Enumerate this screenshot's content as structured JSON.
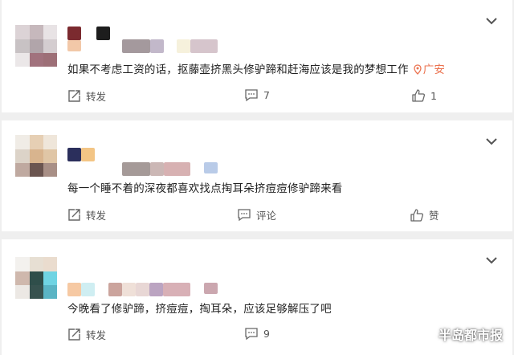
{
  "comments": [
    {
      "text": "如果不考虑工资的话，抠藤壶挤黑头修驴蹄和赶海应该是我的梦想工作",
      "location": "广安",
      "actions": {
        "repost": "转发",
        "comment": "7",
        "like": "1"
      }
    },
    {
      "text": "每一个睡不着的深夜都喜欢找点掏耳朵挤痘痘修驴蹄来看",
      "location": "",
      "actions": {
        "repost": "转发",
        "comment": "评论",
        "like": "赞"
      }
    },
    {
      "text": "今晚看了修驴蹄，挤痘痘，掏耳朵，应该足够解压了吧",
      "location": "",
      "actions": {
        "repost": "转发",
        "comment": "9",
        "like": ""
      }
    }
  ],
  "watermark": "半岛都市报",
  "colors": {
    "location": "#eb7350",
    "background": "#efefef",
    "card": "#ffffff"
  },
  "icons": [
    "chevron-down-icon",
    "repost-icon",
    "comment-icon",
    "like-icon",
    "location-pin-icon"
  ]
}
